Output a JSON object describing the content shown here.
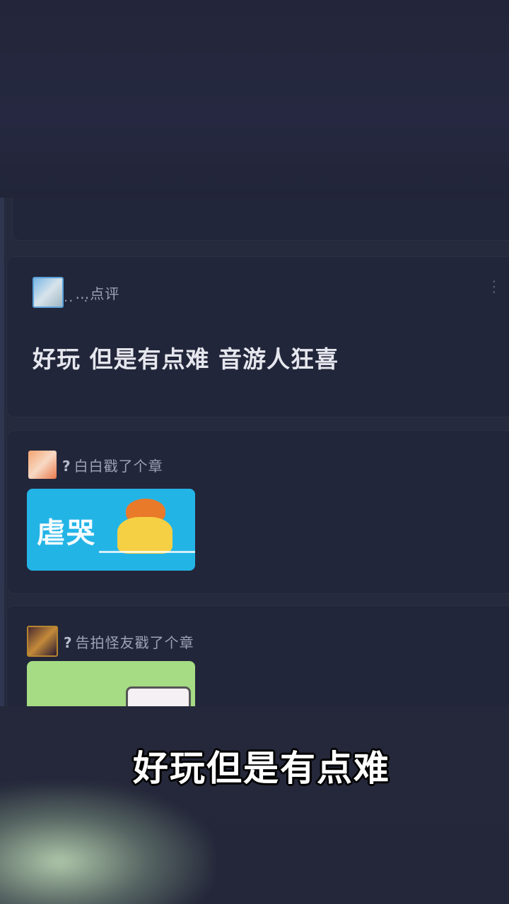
{
  "comments": [
    {
      "avatar": "user-avatar",
      "username": "̣ ̣…̣点评",
      "comment_text": "好玩 但是有点难 音游人狂喜",
      "menu_icon": "⋮"
    },
    {
      "avatar": "user-avatar",
      "prefix": "?",
      "username": "白白戳了个章",
      "sticker_text": "虐哭",
      "sticker_color": "#23b4e6"
    },
    {
      "avatar": "user-avatar",
      "prefix": "?",
      "username": "告拍怪友戳了个章",
      "sticker_color": "#a5dc84"
    }
  ],
  "subtitle": "好玩但是有点难"
}
